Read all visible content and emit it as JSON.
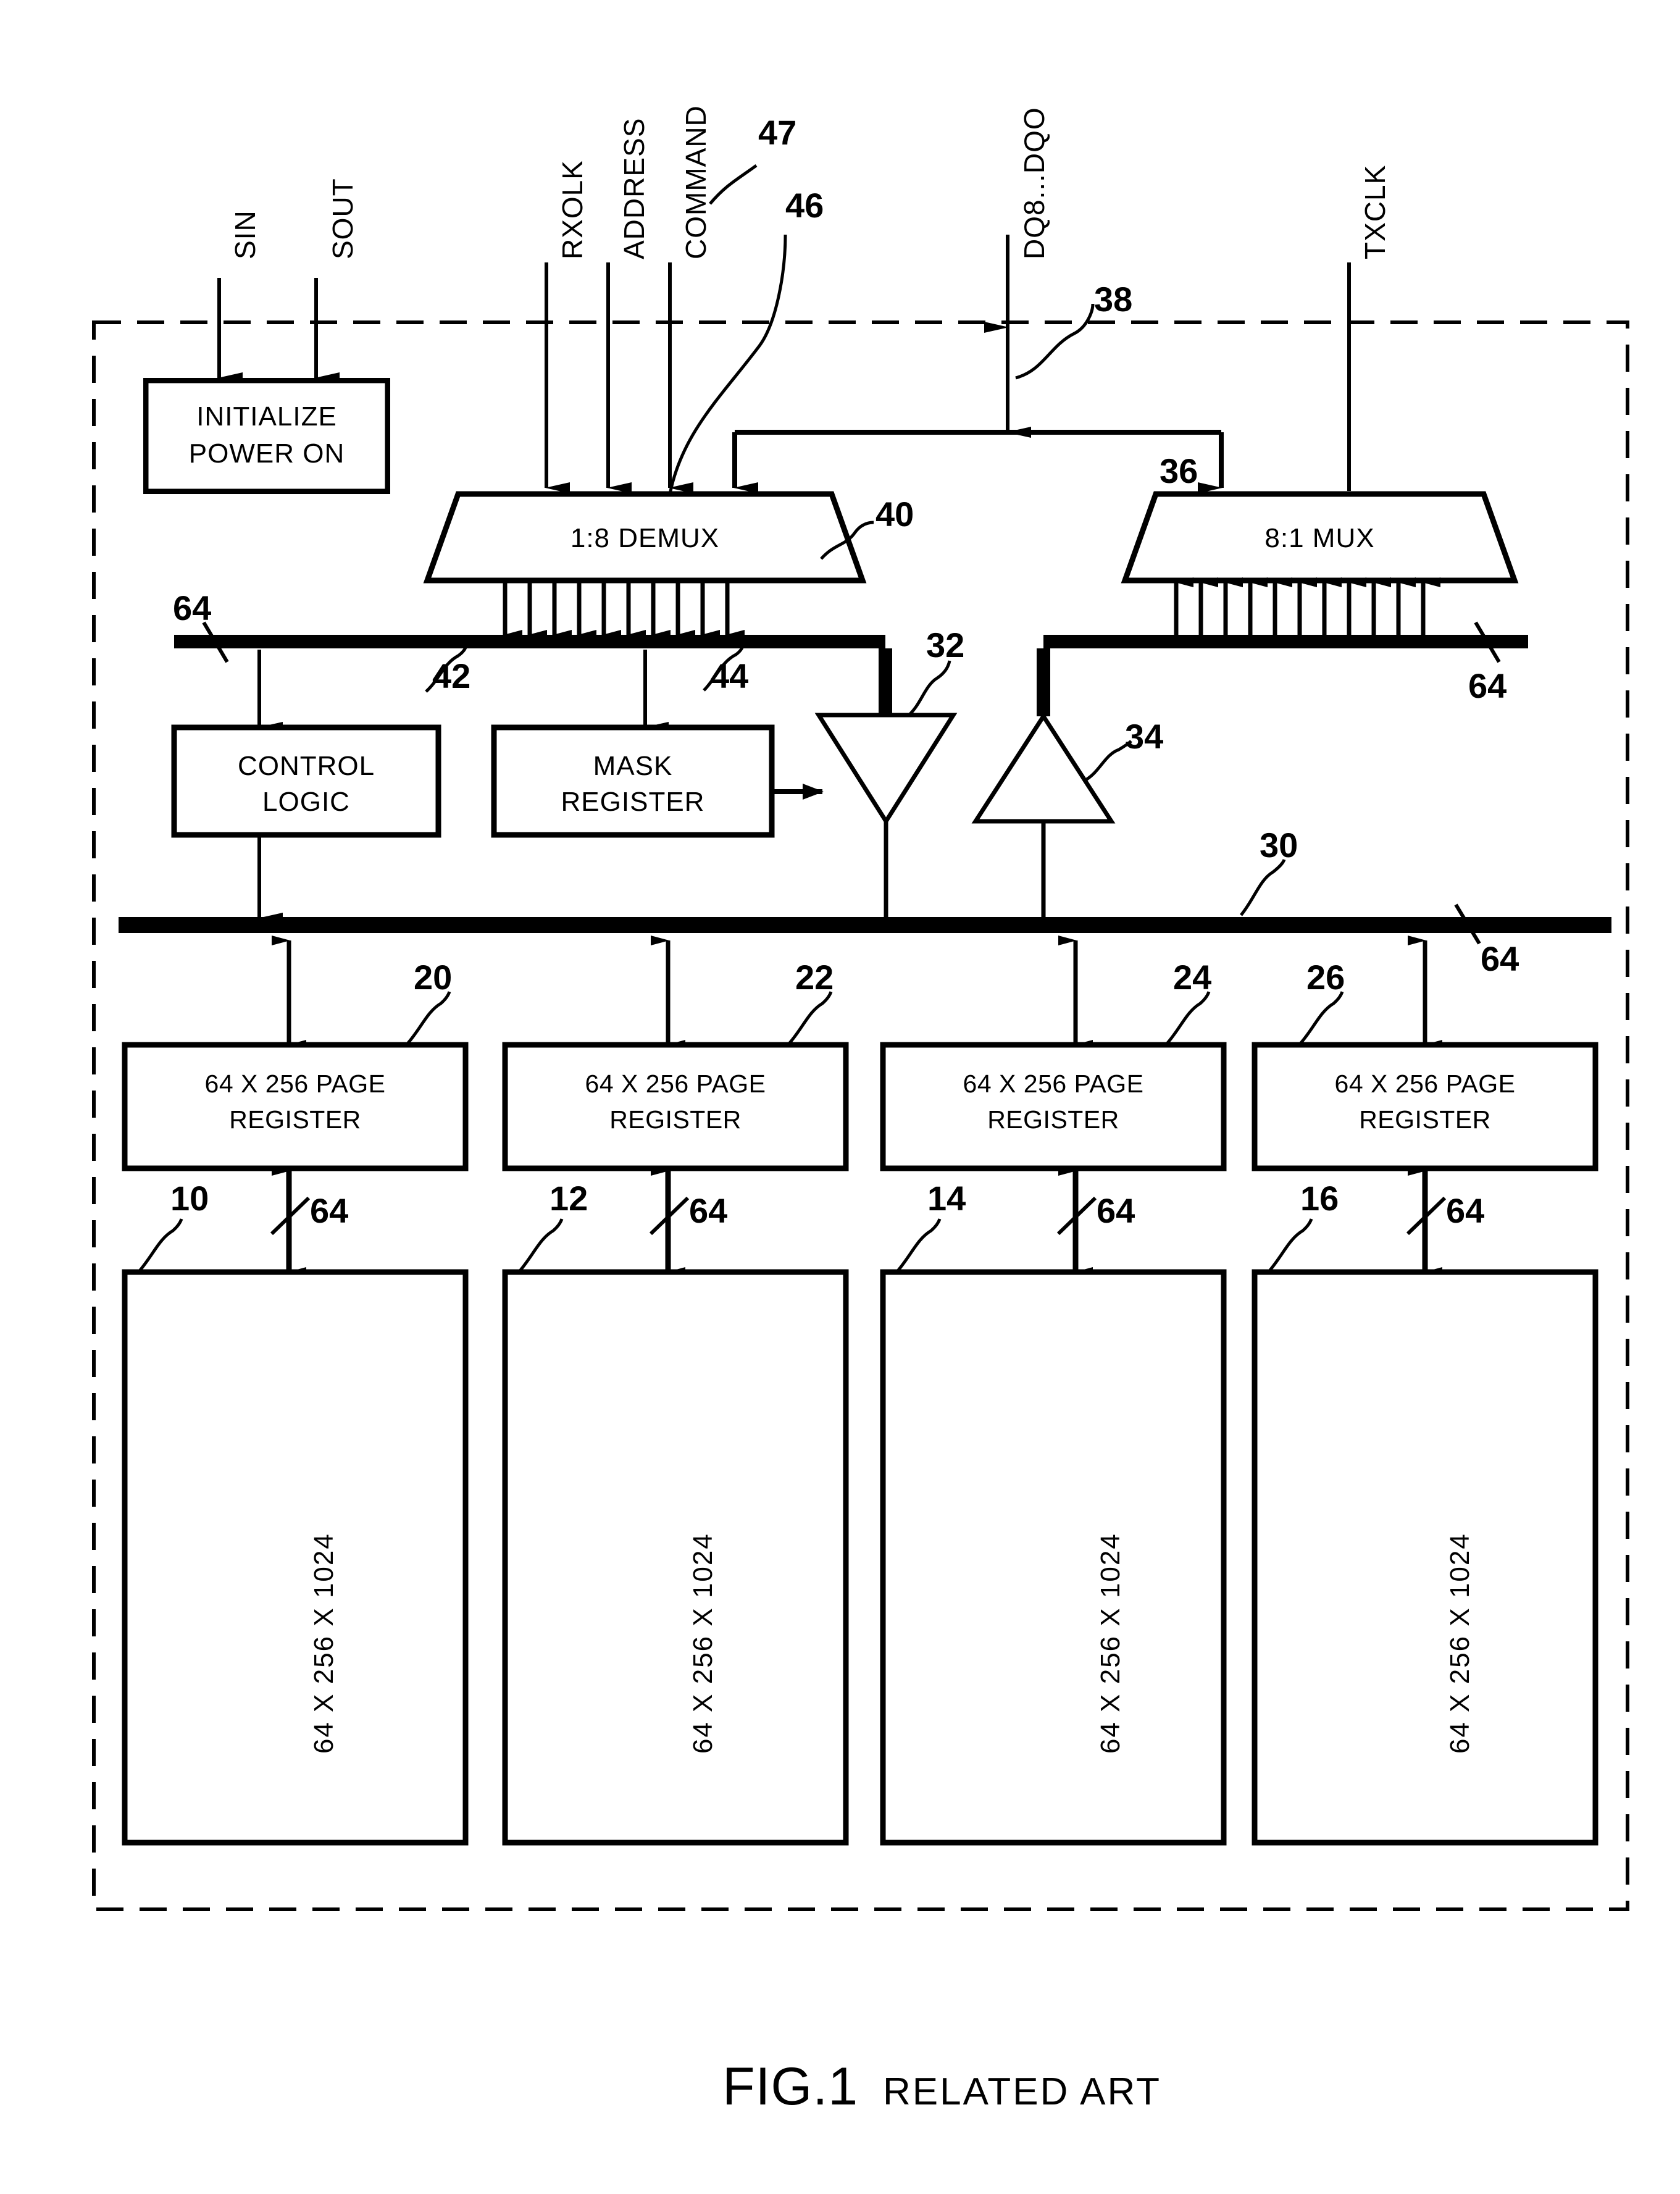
{
  "figure": {
    "caption_main": "FIG.1",
    "caption_sub": "RELATED ART"
  },
  "signals": {
    "sin": "SIN",
    "sout": "SOUT",
    "rxclk": "RXOLK",
    "address": "ADDRESS",
    "command": "COMMAND",
    "dq": "DQ8...DQO",
    "txclk": "TXCLK"
  },
  "blocks": {
    "initialize": {
      "line1": "INITIALIZE",
      "line2": "POWER  ON"
    },
    "demux": {
      "label": "1:8  DEMUX"
    },
    "mux": {
      "label": "8:1  MUX"
    },
    "control_logic": {
      "line1": "CONTROL",
      "line2": "LOGIC"
    },
    "mask_register": {
      "line1": "MASK",
      "line2": "REGISTER"
    },
    "page_registers": [
      {
        "line1": "64  X  256 PAGE",
        "line2": "REGISTER"
      },
      {
        "line1": "64  X  256 PAGE",
        "line2": "REGISTER"
      },
      {
        "line1": "64  X  256 PAGE",
        "line2": "REGISTER"
      },
      {
        "line1": "64  X  256 PAGE",
        "line2": "REGISTER"
      }
    ],
    "memory_arrays": [
      {
        "label": "64 X 256 X 1024"
      },
      {
        "label": "64 X 256 X 1024"
      },
      {
        "label": "64 X 256 X 1024"
      },
      {
        "label": "64 X 256 X 1024"
      }
    ]
  },
  "refs": {
    "r47": "47",
    "r46": "46",
    "r38": "38",
    "r40": "40",
    "r36": "36",
    "r32": "32",
    "r34": "34",
    "r42": "42",
    "r44": "44",
    "r30": "30",
    "r20": "20",
    "r22": "22",
    "r24": "24",
    "r26": "26",
    "r10": "10",
    "r12": "12",
    "r14": "14",
    "r16": "16",
    "bus_left_64": "64",
    "bus_right_64": "64",
    "bus_main_64": "64",
    "w64_a": "64",
    "w64_b": "64",
    "w64_c": "64",
    "w64_d": "64"
  },
  "colors": {
    "ink": "#000000",
    "paper": "#ffffff"
  }
}
